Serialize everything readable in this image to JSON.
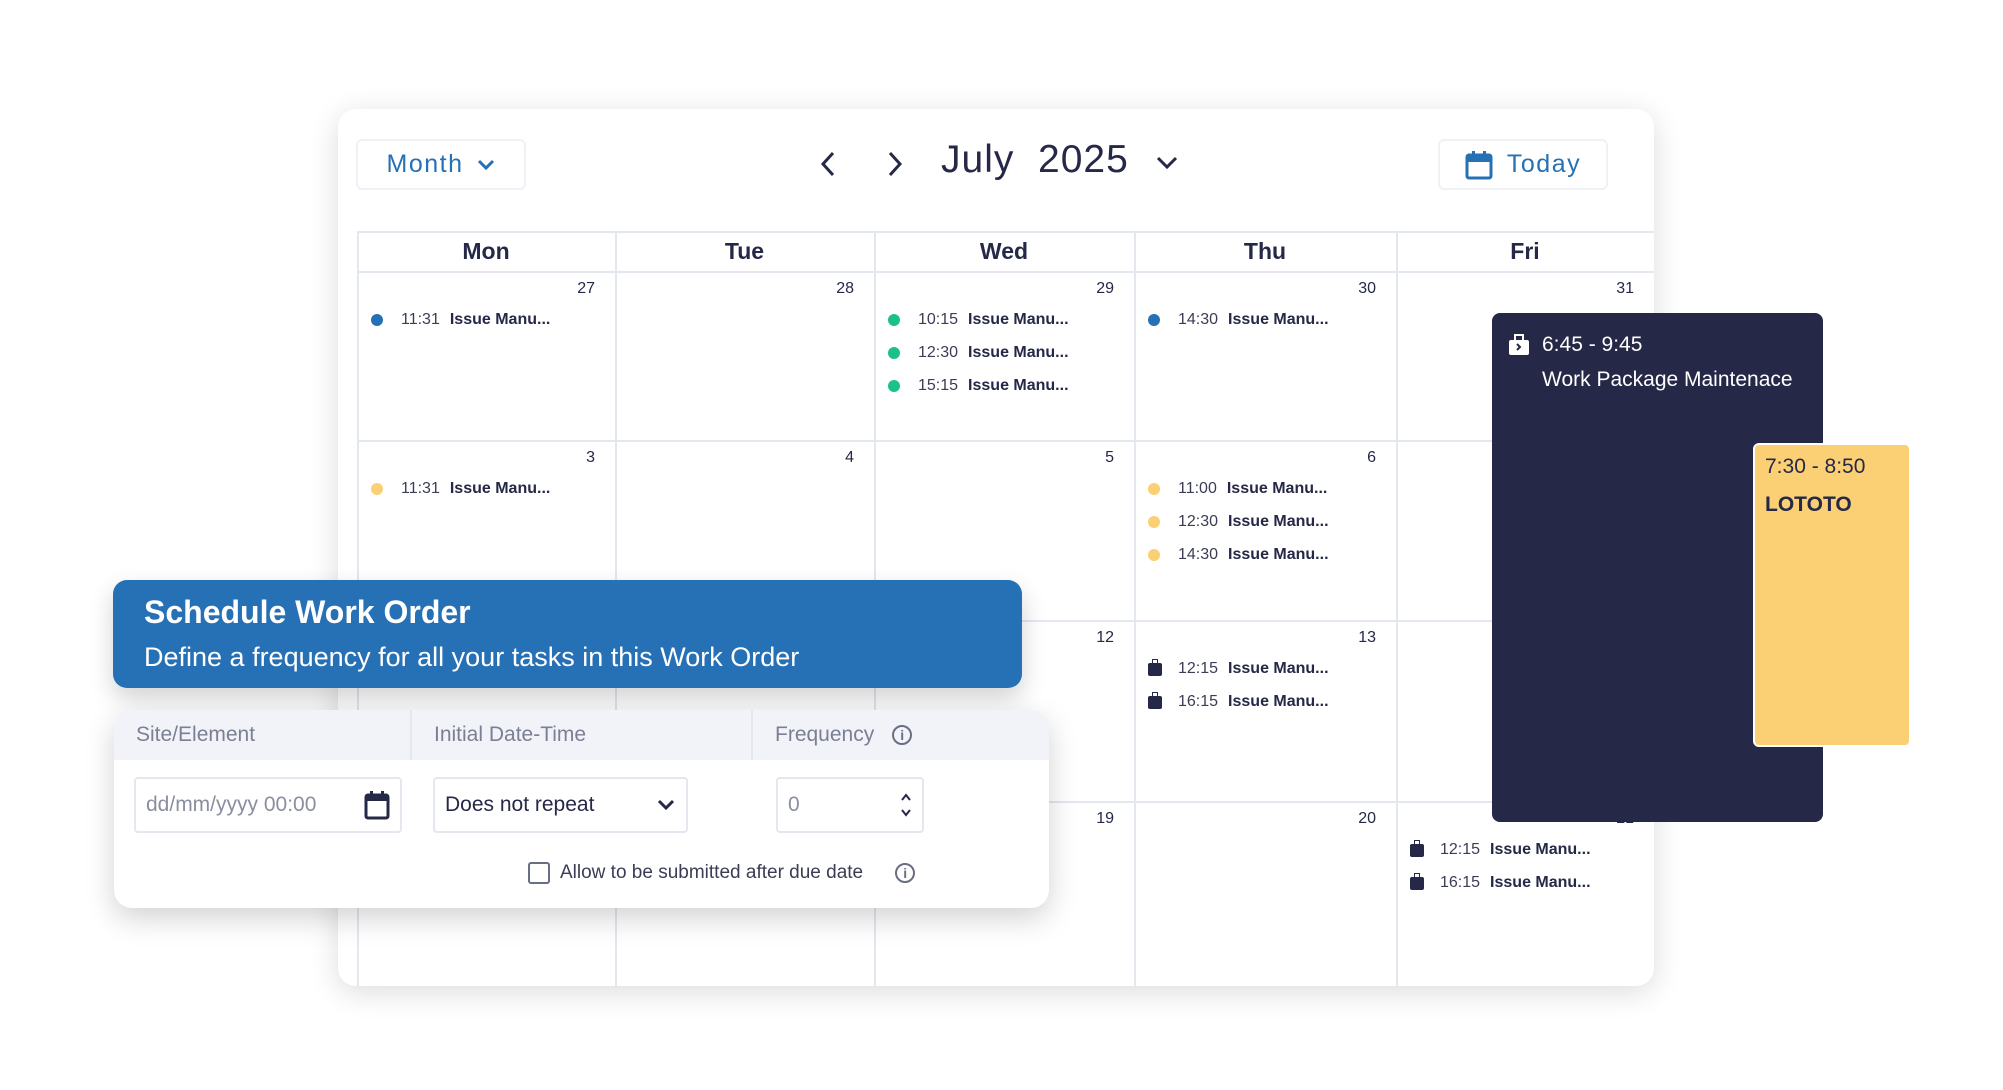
{
  "toolbar": {
    "view_label": "Month",
    "month": "July",
    "year": "2025",
    "today_label": "Today",
    "prev_icon": "chevron-left",
    "next_icon": "chevron-right"
  },
  "weekdays": [
    "Mon",
    "Tue",
    "Wed",
    "Thu",
    "Fri"
  ],
  "colors": {
    "accent": "#2670b5",
    "green": "#1cc08a",
    "yellow": "#fbcf74",
    "dark": "#252847"
  },
  "cells": [
    {
      "day": "27",
      "row": 0,
      "col": 0,
      "events": [
        {
          "time": "11:31",
          "label": "Issue Manu...",
          "marker": "dot",
          "color": "#2670b5"
        }
      ]
    },
    {
      "day": "28",
      "row": 0,
      "col": 1,
      "events": []
    },
    {
      "day": "29",
      "row": 0,
      "col": 2,
      "events": [
        {
          "time": "10:15",
          "label": "Issue Manu...",
          "marker": "dot",
          "color": "#1cc08a"
        },
        {
          "time": "12:30",
          "label": "Issue Manu...",
          "marker": "dot",
          "color": "#1cc08a"
        },
        {
          "time": "15:15",
          "label": "Issue Manu...",
          "marker": "dot",
          "color": "#1cc08a"
        }
      ]
    },
    {
      "day": "30",
      "row": 0,
      "col": 3,
      "events": [
        {
          "time": "14:30",
          "label": "Issue Manu...",
          "marker": "dot",
          "color": "#2670b5"
        }
      ]
    },
    {
      "day": "31",
      "row": 0,
      "col": 4,
      "events": []
    },
    {
      "day": "3",
      "row": 1,
      "col": 0,
      "events": [
        {
          "time": "11:31",
          "label": "Issue Manu...",
          "marker": "dot",
          "color": "#fbcf74"
        }
      ]
    },
    {
      "day": "4",
      "row": 1,
      "col": 1,
      "events": []
    },
    {
      "day": "5",
      "row": 1,
      "col": 2,
      "events": []
    },
    {
      "day": "6",
      "row": 1,
      "col": 3,
      "events": [
        {
          "time": "11:00",
          "label": "Issue Manu...",
          "marker": "dot",
          "color": "#fbcf74"
        },
        {
          "time": "12:30",
          "label": "Issue Manu...",
          "marker": "dot",
          "color": "#fbcf74"
        },
        {
          "time": "14:30",
          "label": "Issue Manu...",
          "marker": "dot",
          "color": "#fbcf74"
        }
      ]
    },
    {
      "day": "12",
      "row": 2,
      "col": 2,
      "events": []
    },
    {
      "day": "13",
      "row": 2,
      "col": 3,
      "events": [
        {
          "time": "12:15",
          "label": "Issue Manu...",
          "marker": "briefcase"
        },
        {
          "time": "16:15",
          "label": "Issue Manu...",
          "marker": "briefcase"
        }
      ]
    },
    {
      "day": "19",
      "row": 3,
      "col": 2,
      "events": []
    },
    {
      "day": "20",
      "row": 3,
      "col": 3,
      "events": []
    },
    {
      "day": "21",
      "row": 3,
      "col": 4,
      "events": [
        {
          "time": "12:15",
          "label": "Issue Manu...",
          "marker": "briefcase"
        },
        {
          "time": "16:15",
          "label": "Issue Manu...",
          "marker": "briefcase"
        }
      ]
    }
  ],
  "popup_event": {
    "time": "6:45 - 9:45",
    "title": "Work Package Maintenace"
  },
  "lototo_event": {
    "time": "7:30 - 8:50",
    "title": "LOTOTO"
  },
  "banner": {
    "title": "Schedule Work Order",
    "subtitle": "Define a frequency for all your tasks in this Work Order"
  },
  "form": {
    "col_site": "Site/Element",
    "col_initial": "Initial Date-Time",
    "col_frequency": "Frequency",
    "date_placeholder": "dd/mm/yyyy 00:00",
    "repeat_value": "Does not repeat",
    "frequency_value": "0",
    "checkbox_label": "Allow to be submitted after due date",
    "checkbox_checked": false
  }
}
